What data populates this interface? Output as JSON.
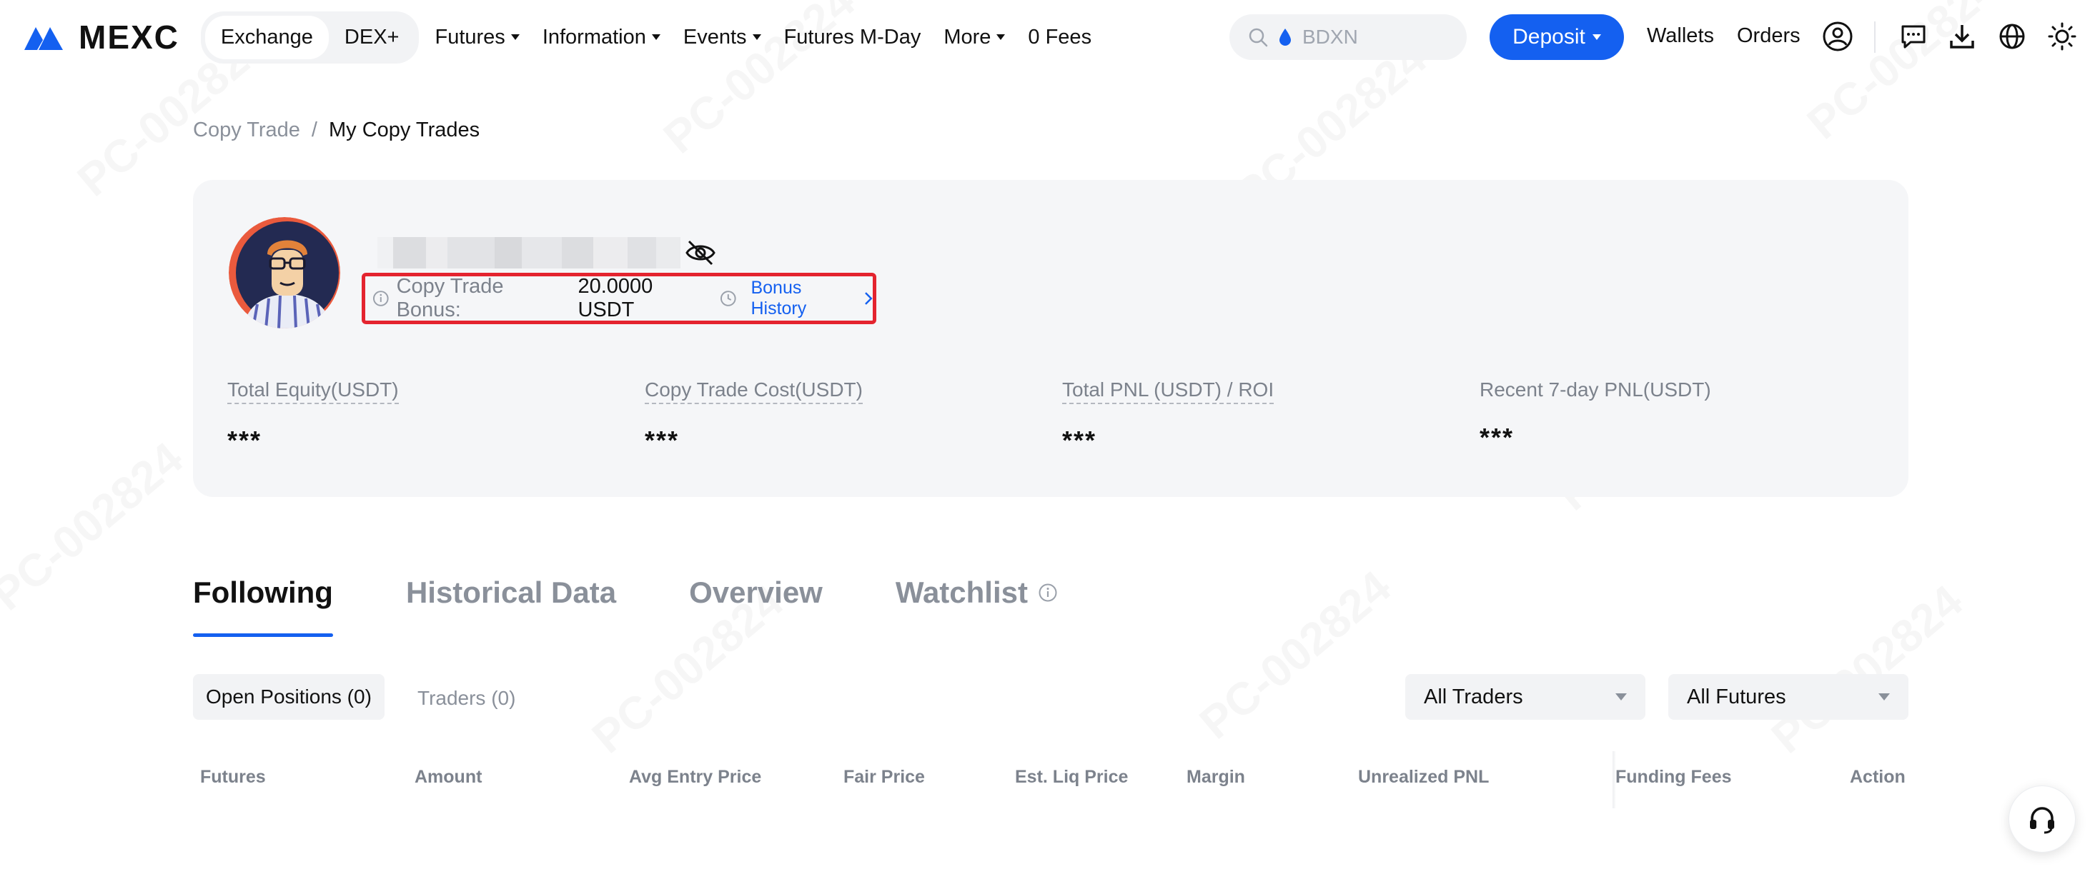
{
  "header": {
    "brand": "MEXC",
    "segments": [
      "Exchange",
      "DEX+"
    ],
    "nav": [
      {
        "label": "Futures",
        "dropdown": true
      },
      {
        "label": "Information",
        "dropdown": true
      },
      {
        "label": "Events",
        "dropdown": true
      },
      {
        "label": "Futures M-Day",
        "dropdown": false
      },
      {
        "label": "More",
        "dropdown": true
      },
      {
        "label": "0 Fees",
        "dropdown": false
      }
    ],
    "search_placeholder": "BDXN",
    "deposit_label": "Deposit",
    "wallets_label": "Wallets",
    "orders_label": "Orders",
    "icons": [
      "user-icon",
      "message-icon",
      "download-icon",
      "globe-icon",
      "theme-sun-icon"
    ]
  },
  "breadcrumb": {
    "parent": "Copy Trade",
    "separator": "/",
    "current": "My Copy Trades"
  },
  "profile": {
    "bonus_label": "Copy Trade Bonus:",
    "bonus_value": "20.0000 USDT",
    "bonus_history_label": "Bonus History",
    "stats": [
      {
        "label": "Total Equity(USDT)",
        "value": "***",
        "dashed": true
      },
      {
        "label": "Copy Trade Cost(USDT)",
        "value": "***",
        "dashed": true
      },
      {
        "label": "Total PNL (USDT) / ROI",
        "value": "***",
        "dashed": true
      },
      {
        "label": "Recent 7-day PNL(USDT)",
        "value": "***",
        "dashed": false
      }
    ]
  },
  "tabs": [
    "Following",
    "Historical Data",
    "Overview",
    "Watchlist"
  ],
  "subtabs": {
    "open_positions": "Open Positions (0)",
    "traders": "Traders (0)"
  },
  "filters": {
    "traders": "All Traders",
    "futures": "All Futures"
  },
  "table": {
    "columns": [
      "Futures",
      "Amount",
      "Avg Entry Price",
      "Fair Price",
      "Est. Liq Price",
      "Margin",
      "Unrealized PNL",
      "Funding Fees",
      "Action"
    ]
  },
  "watermark": "PC-002824",
  "colors": {
    "brand": "#1460f0",
    "highlight": "#e4242f"
  }
}
